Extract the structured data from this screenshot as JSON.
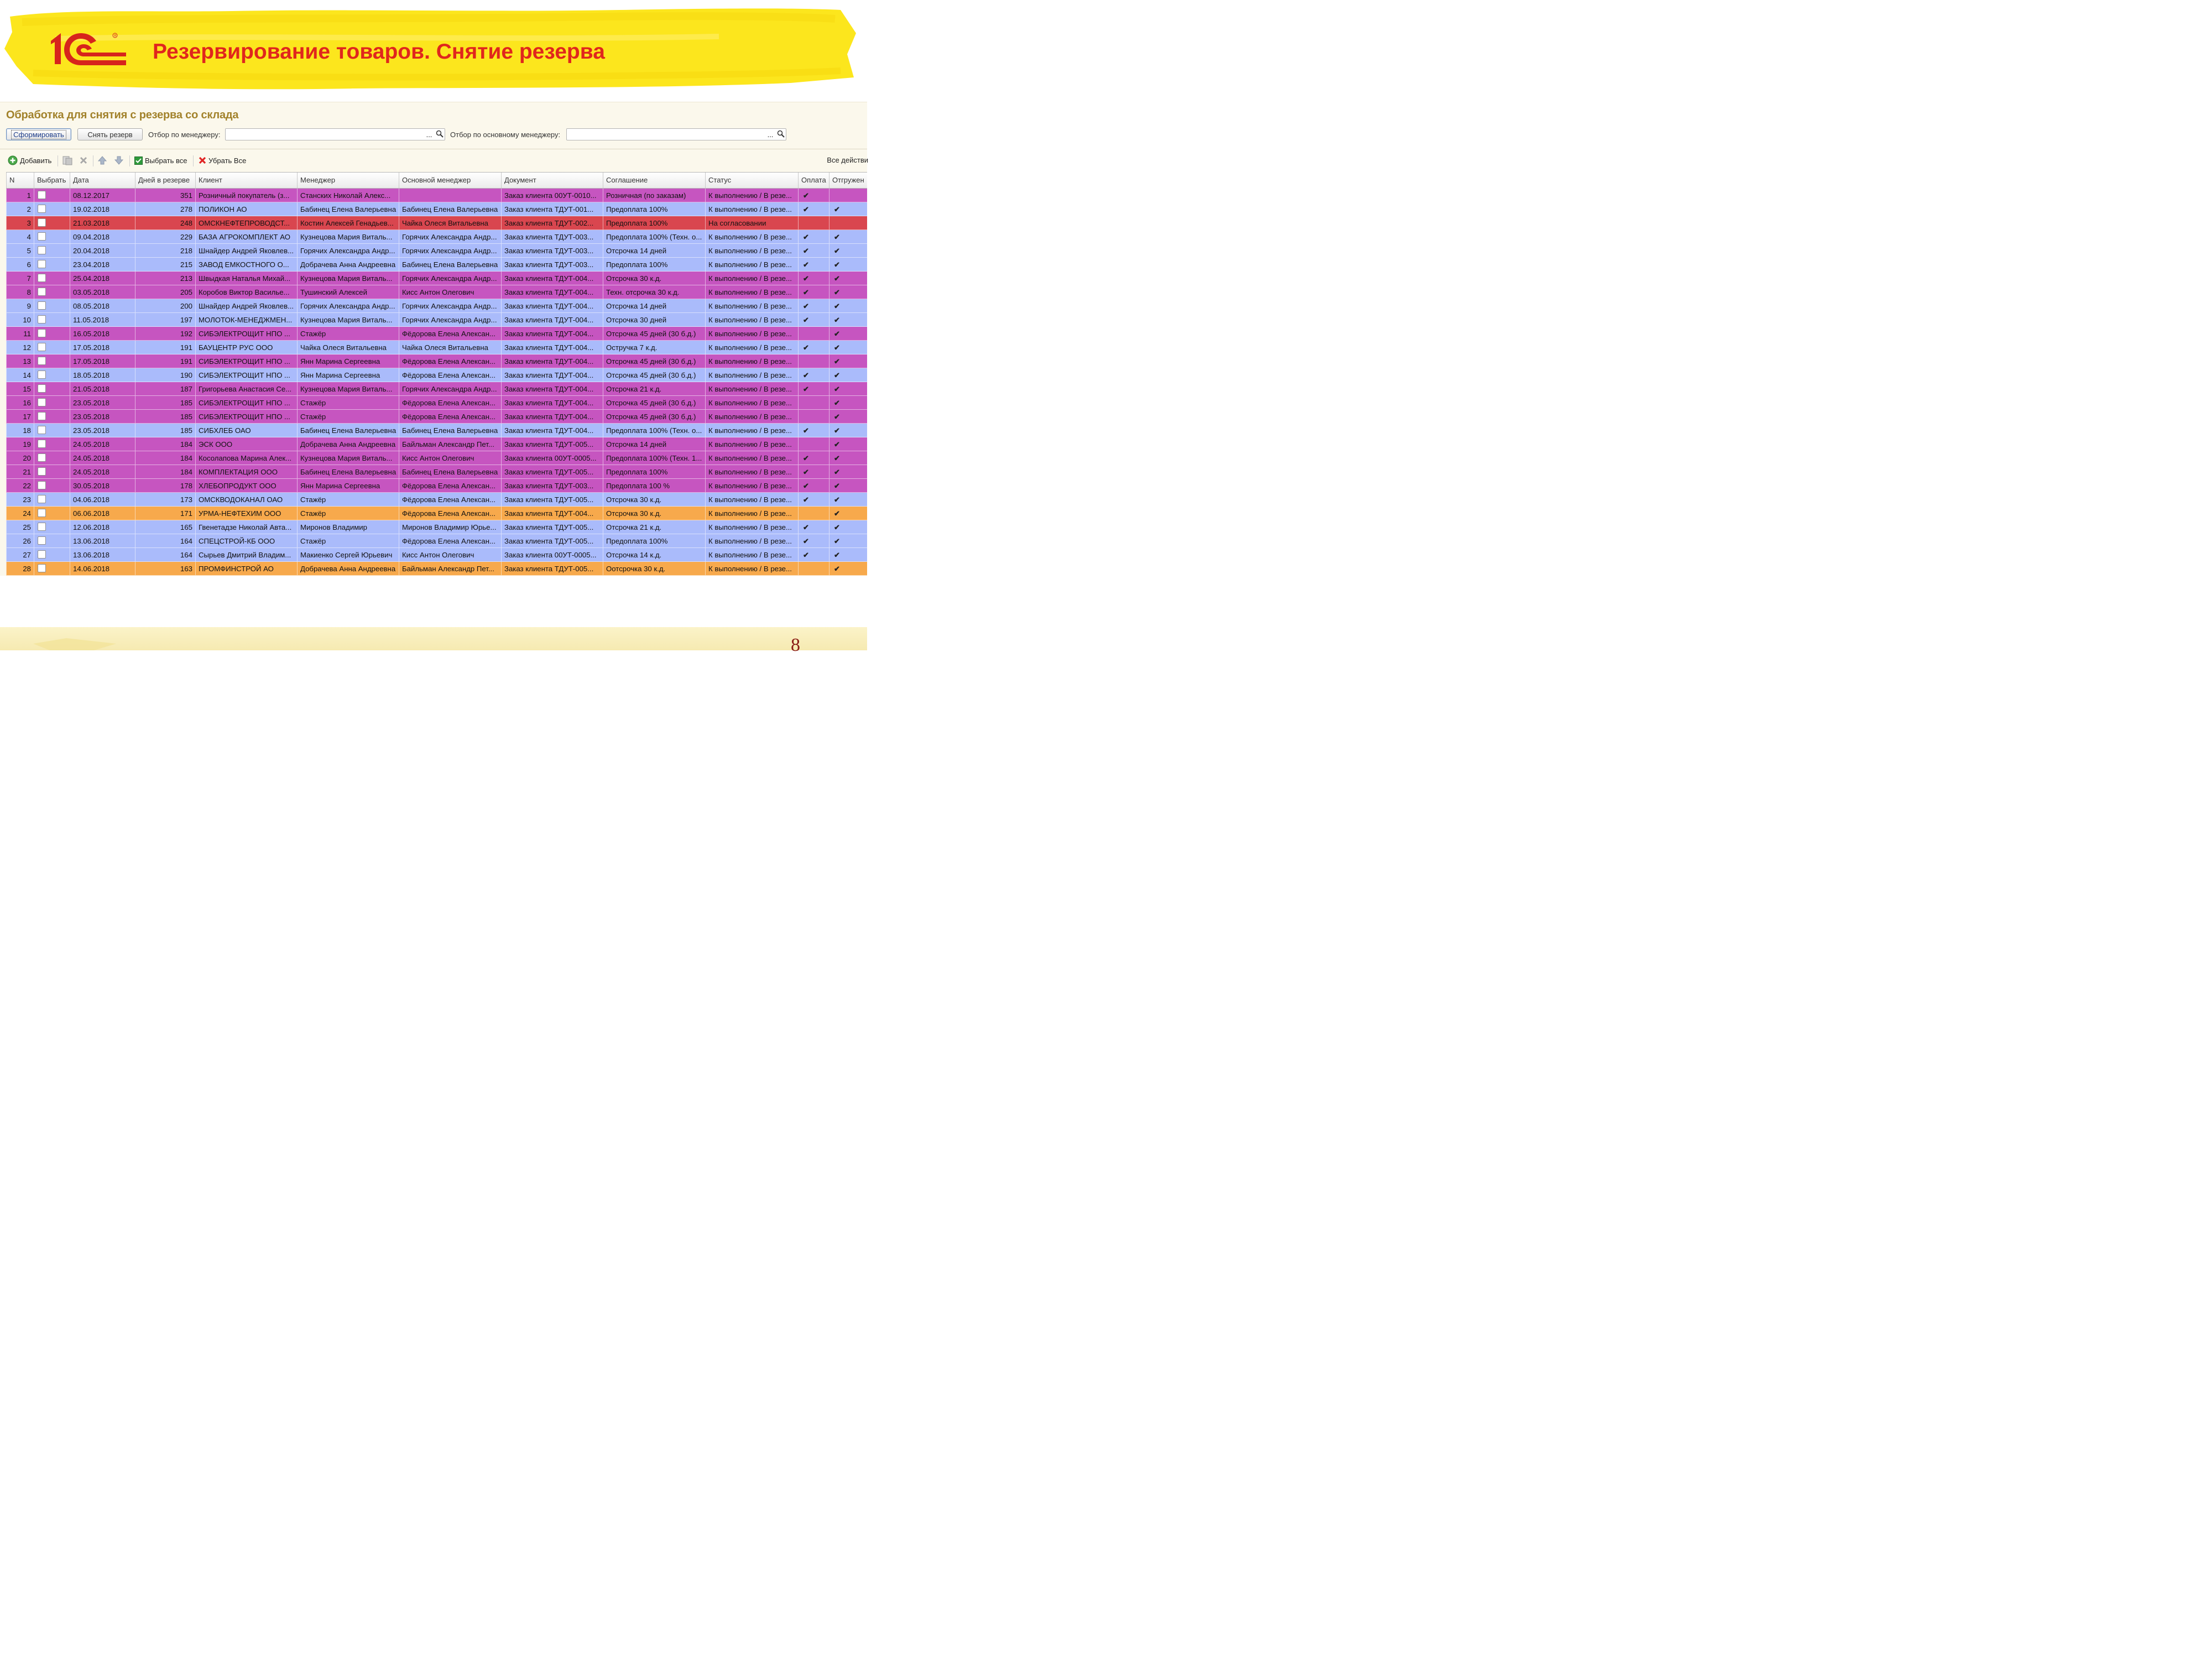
{
  "slide": {
    "title": "Резервирование товаров. Снятие резерва",
    "page_number": "8",
    "logo_text": "1С",
    "colors": {
      "title": "#e0261d",
      "banner": "#fce61d",
      "logo": "#d7241c"
    }
  },
  "form": {
    "title": "Обработка для снятия с резерва со склада",
    "buttons": {
      "generate": "Сформировать",
      "remove_reserve": "Снять резерв"
    },
    "filter_manager_label": "Отбор по менеджеру:",
    "filter_main_manager_label": "Отбор по основному менеджеру:",
    "filter_manager_value": "",
    "filter_main_manager_value": "",
    "select_button": "...",
    "search_icon": "magnifier-icon"
  },
  "toolbar": {
    "add": "Добавить",
    "select_all": "Выбрать все",
    "deselect_all": "Убрать Все",
    "all_actions": "Все действи",
    "icons": [
      "add-icon",
      "copy-icon",
      "delete-icon",
      "move-up-icon",
      "move-down-icon",
      "select-all-icon",
      "deselect-all-icon"
    ]
  },
  "table": {
    "columns": [
      "N",
      "Выбрать",
      "Дата",
      "Дней в резерве",
      "Клиент",
      "Менеджер",
      "Основной менеджер",
      "Документ",
      "Соглашение",
      "Статус",
      "Оплата",
      "Отгружен"
    ],
    "row_colors": {
      "purple": "#c655c0",
      "blue": "#aabbfb",
      "red": "#d9464f",
      "orange": "#f7a94c"
    },
    "rows": [
      {
        "n": "1",
        "date": "08.12.2017",
        "days": "351",
        "client": "Розничный покупатель (з...",
        "manager": "Станских Николай Алекс...",
        "main_manager": "",
        "document": "Заказ клиента 00УТ-0010...",
        "agreement": "Розничная (по заказам)",
        "status": "К выполнению / В резе...",
        "paid": "✔",
        "shipped": "",
        "color": "purple"
      },
      {
        "n": "2",
        "date": "19.02.2018",
        "days": "278",
        "client": "ПОЛИКОН АО",
        "manager": "Бабинец Елена Валерьевна",
        "main_manager": "Бабинец Елена Валерьевна",
        "document": "Заказ клиента ТДУТ-001...",
        "agreement": "Предоплата 100%",
        "status": "К выполнению / В резе...",
        "paid": "✔",
        "shipped": "✔",
        "color": "blue"
      },
      {
        "n": "3",
        "date": "21.03.2018",
        "days": "248",
        "client": "ОМСКНЕФТЕПРОВОДСТ...",
        "manager": "Костин Алексей Генадьев...",
        "main_manager": "Чайка Олеся Витальевна",
        "document": "Заказ клиента ТДУТ-002...",
        "agreement": "Предоплата 100%",
        "status": "На согласовании",
        "paid": "",
        "shipped": "",
        "color": "red"
      },
      {
        "n": "4",
        "date": "09.04.2018",
        "days": "229",
        "client": "БАЗА АГРОКОМПЛЕКТ АО",
        "manager": "Кузнецова Мария Виталь...",
        "main_manager": "Горячих Александра Андр...",
        "document": "Заказ клиента ТДУТ-003...",
        "agreement": "Предоплата 100% (Техн. о...",
        "status": "К выполнению / В резе...",
        "paid": "✔",
        "shipped": "✔",
        "color": "blue"
      },
      {
        "n": "5",
        "date": "20.04.2018",
        "days": "218",
        "client": "Шнайдер Андрей Яковлев...",
        "manager": "Горячих Александра Андр...",
        "main_manager": "Горячих Александра Андр...",
        "document": "Заказ клиента ТДУТ-003...",
        "agreement": "Отсрочка 14 дней",
        "status": "К выполнению / В резе...",
        "paid": "✔",
        "shipped": "✔",
        "color": "blue"
      },
      {
        "n": "6",
        "date": "23.04.2018",
        "days": "215",
        "client": "ЗАВОД ЕМКОСТНОГО О...",
        "manager": "Добрачева Анна Андреевна",
        "main_manager": "Бабинец Елена Валерьевна",
        "document": "Заказ клиента ТДУТ-003...",
        "agreement": "Предоплата 100%",
        "status": "К выполнению / В резе...",
        "paid": "✔",
        "shipped": "✔",
        "color": "blue"
      },
      {
        "n": "7",
        "date": "25.04.2018",
        "days": "213",
        "client": "Швыдкая Наталья Михай...",
        "manager": "Кузнецова Мария Виталь...",
        "main_manager": "Горячих Александра Андр...",
        "document": "Заказ клиента ТДУТ-004...",
        "agreement": "Отсрочка 30 к.д.",
        "status": "К выполнению / В резе...",
        "paid": "✔",
        "shipped": "✔",
        "color": "purple"
      },
      {
        "n": "8",
        "date": "03.05.2018",
        "days": "205",
        "client": "Коробов Виктор Василье...",
        "manager": "Тушинский Алексей",
        "main_manager": "Кисс Антон Олегович",
        "document": "Заказ клиента ТДУТ-004...",
        "agreement": "Техн. отсрочка 30 к.д.",
        "status": "К выполнению / В резе...",
        "paid": "✔",
        "shipped": "✔",
        "color": "purple"
      },
      {
        "n": "9",
        "date": "08.05.2018",
        "days": "200",
        "client": "Шнайдер Андрей Яковлев...",
        "manager": "Горячих Александра Андр...",
        "main_manager": "Горячих Александра Андр...",
        "document": "Заказ клиента ТДУТ-004...",
        "agreement": "Отсрочка 14 дней",
        "status": "К выполнению / В резе...",
        "paid": "✔",
        "shipped": "✔",
        "color": "blue"
      },
      {
        "n": "10",
        "date": "11.05.2018",
        "days": "197",
        "client": "МОЛОТОК-МЕНЕДЖМЕН...",
        "manager": "Кузнецова Мария Виталь...",
        "main_manager": "Горячих Александра Андр...",
        "document": "Заказ клиента ТДУТ-004...",
        "agreement": "Отсрочка 30 дней",
        "status": "К выполнению / В резе...",
        "paid": "✔",
        "shipped": "✔",
        "color": "blue"
      },
      {
        "n": "11",
        "date": "16.05.2018",
        "days": "192",
        "client": "СИБЭЛЕКТРОЩИТ НПО ...",
        "manager": "Стажёр",
        "main_manager": "Фёдорова Елена Алексан...",
        "document": "Заказ клиента ТДУТ-004...",
        "agreement": "Отсрочка 45 дней (30 б.д.)",
        "status": "К выполнению / В резе...",
        "paid": "",
        "shipped": "✔",
        "color": "purple"
      },
      {
        "n": "12",
        "date": "17.05.2018",
        "days": "191",
        "client": "БАУЦЕНТР РУС ООО",
        "manager": "Чайка Олеся Витальевна",
        "main_manager": "Чайка Олеся Витальевна",
        "document": "Заказ клиента ТДУТ-004...",
        "agreement": "Остручка 7 к.д.",
        "status": "К выполнению / В резе...",
        "paid": "✔",
        "shipped": "✔",
        "color": "blue"
      },
      {
        "n": "13",
        "date": "17.05.2018",
        "days": "191",
        "client": "СИБЭЛЕКТРОЩИТ НПО ...",
        "manager": "Янн Марина Сергеевна",
        "main_manager": "Фёдорова Елена Алексан...",
        "document": "Заказ клиента ТДУТ-004...",
        "agreement": "Отсрочка 45 дней (30 б.д.)",
        "status": "К выполнению / В резе...",
        "paid": "",
        "shipped": "✔",
        "color": "purple"
      },
      {
        "n": "14",
        "date": "18.05.2018",
        "days": "190",
        "client": "СИБЭЛЕКТРОЩИТ НПО ...",
        "manager": "Янн Марина Сергеевна",
        "main_manager": "Фёдорова Елена Алексан...",
        "document": "Заказ клиента ТДУТ-004...",
        "agreement": "Отсрочка 45 дней (30 б.д.)",
        "status": "К выполнению / В резе...",
        "paid": "✔",
        "shipped": "✔",
        "color": "blue"
      },
      {
        "n": "15",
        "date": "21.05.2018",
        "days": "187",
        "client": "Григорьева Анастасия Се...",
        "manager": "Кузнецова Мария Виталь...",
        "main_manager": "Горячих Александра Андр...",
        "document": "Заказ клиента ТДУТ-004...",
        "agreement": "Отсрочка 21 к.д.",
        "status": "К выполнению / В резе...",
        "paid": "✔",
        "shipped": "✔",
        "color": "purple"
      },
      {
        "n": "16",
        "date": "23.05.2018",
        "days": "185",
        "client": "СИБЭЛЕКТРОЩИТ НПО ...",
        "manager": "Стажёр",
        "main_manager": "Фёдорова Елена Алексан...",
        "document": "Заказ клиента ТДУТ-004...",
        "agreement": "Отсрочка 45 дней (30 б.д.)",
        "status": "К выполнению / В резе...",
        "paid": "",
        "shipped": "✔",
        "color": "purple"
      },
      {
        "n": "17",
        "date": "23.05.2018",
        "days": "185",
        "client": "СИБЭЛЕКТРОЩИТ НПО ...",
        "manager": "Стажёр",
        "main_manager": "Фёдорова Елена Алексан...",
        "document": "Заказ клиента ТДУТ-004...",
        "agreement": "Отсрочка 45 дней (30 б.д.)",
        "status": "К выполнению / В резе...",
        "paid": "",
        "shipped": "✔",
        "color": "purple"
      },
      {
        "n": "18",
        "date": "23.05.2018",
        "days": "185",
        "client": "СИБХЛЕБ ОАО",
        "manager": "Бабинец Елена Валерьевна",
        "main_manager": "Бабинец Елена Валерьевна",
        "document": "Заказ клиента ТДУТ-004...",
        "agreement": "Предоплата 100% (Техн. о...",
        "status": "К выполнению / В резе...",
        "paid": "✔",
        "shipped": "✔",
        "color": "blue"
      },
      {
        "n": "19",
        "date": "24.05.2018",
        "days": "184",
        "client": "ЭСК ООО",
        "manager": "Добрачева Анна Андреевна",
        "main_manager": "Байльман Александр Пет...",
        "document": "Заказ клиента ТДУТ-005...",
        "agreement": "Отсрочка 14 дней",
        "status": "К выполнению / В резе...",
        "paid": "",
        "shipped": "✔",
        "color": "purple"
      },
      {
        "n": "20",
        "date": "24.05.2018",
        "days": "184",
        "client": "Косолапова Марина Алек...",
        "manager": "Кузнецова Мария Виталь...",
        "main_manager": "Кисс Антон Олегович",
        "document": "Заказ клиента 00УТ-0005...",
        "agreement": "Предоплата 100% (Техн. 1...",
        "status": "К выполнению / В резе...",
        "paid": "✔",
        "shipped": "✔",
        "color": "purple"
      },
      {
        "n": "21",
        "date": "24.05.2018",
        "days": "184",
        "client": "КОМПЛЕКТАЦИЯ ООО",
        "manager": "Бабинец Елена Валерьевна",
        "main_manager": "Бабинец Елена Валерьевна",
        "document": "Заказ клиента ТДУТ-005...",
        "agreement": "Предоплата 100%",
        "status": "К выполнению / В резе...",
        "paid": "✔",
        "shipped": "✔",
        "color": "purple"
      },
      {
        "n": "22",
        "date": "30.05.2018",
        "days": "178",
        "client": "ХЛЕБОПРОДУКТ ООО",
        "manager": "Янн Марина Сергеевна",
        "main_manager": "Фёдорова Елена Алексан...",
        "document": "Заказ клиента ТДУТ-003...",
        "agreement": "Предоплата 100 %",
        "status": "К выполнению / В резе...",
        "paid": "✔",
        "shipped": "✔",
        "color": "purple"
      },
      {
        "n": "23",
        "date": "04.06.2018",
        "days": "173",
        "client": "ОМСКВОДОКАНАЛ ОАО",
        "manager": "Стажёр",
        "main_manager": "Фёдорова Елена Алексан...",
        "document": "Заказ клиента ТДУТ-005...",
        "agreement": "Отсрочка 30 к.д.",
        "status": "К выполнению / В резе...",
        "paid": "✔",
        "shipped": "✔",
        "color": "blue"
      },
      {
        "n": "24",
        "date": "06.06.2018",
        "days": "171",
        "client": "УРМА-НЕФТЕХИМ ООО",
        "manager": "Стажёр",
        "main_manager": "Фёдорова Елена Алексан...",
        "document": "Заказ клиента ТДУТ-004...",
        "agreement": "Отсрочка 30 к.д.",
        "status": "К выполнению / В резе...",
        "paid": "",
        "shipped": "✔",
        "color": "orange"
      },
      {
        "n": "25",
        "date": "12.06.2018",
        "days": "165",
        "client": "Гвенетадзе Николай Авта...",
        "manager": "Миронов Владимир",
        "main_manager": "Миронов Владимир Юрье...",
        "document": "Заказ клиента ТДУТ-005...",
        "agreement": "Отсрочка 21 к.д.",
        "status": "К выполнению / В резе...",
        "paid": "✔",
        "shipped": "✔",
        "color": "blue"
      },
      {
        "n": "26",
        "date": "13.06.2018",
        "days": "164",
        "client": "СПЕЦСТРОЙ-КБ ООО",
        "manager": "Стажёр",
        "main_manager": "Фёдорова Елена Алексан...",
        "document": "Заказ клиента ТДУТ-005...",
        "agreement": "Предоплата 100%",
        "status": "К выполнению / В резе...",
        "paid": "✔",
        "shipped": "✔",
        "color": "blue"
      },
      {
        "n": "27",
        "date": "13.06.2018",
        "days": "164",
        "client": "Сырьев Дмитрий Владим...",
        "manager": "Макиенко Сергей Юрьевич",
        "main_manager": "Кисс Антон Олегович",
        "document": "Заказ клиента 00УТ-0005...",
        "agreement": "Отсрочка 14 к.д.",
        "status": "К выполнению / В резе...",
        "paid": "✔",
        "shipped": "✔",
        "color": "blue"
      },
      {
        "n": "28",
        "date": "14.06.2018",
        "days": "163",
        "client": "ПРОМФИНСТРОЙ АО",
        "manager": "Добрачева Анна Андреевна",
        "main_manager": "Байльман Александр Пет...",
        "document": "Заказ клиента ТДУТ-005...",
        "agreement": "Оотсрочка 30 к.д.",
        "status": "К выполнению / В резе...",
        "paid": "",
        "shipped": "✔",
        "color": "orange"
      }
    ]
  }
}
